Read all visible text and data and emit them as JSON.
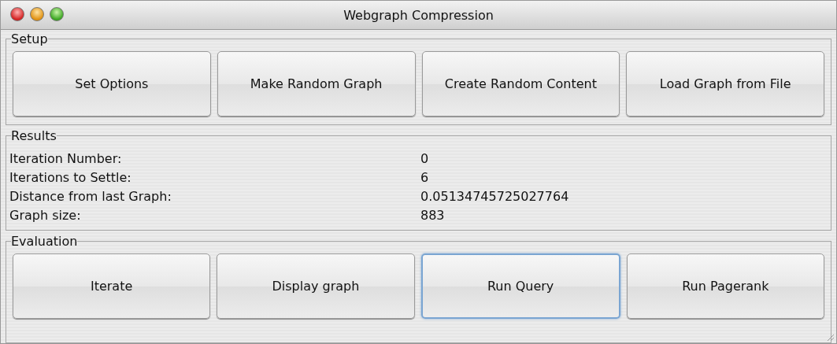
{
  "window": {
    "title": "Webgraph Compression"
  },
  "setup": {
    "title": "Setup",
    "buttons": [
      {
        "label": "Set Options",
        "focused": false
      },
      {
        "label": "Make Random Graph",
        "focused": false
      },
      {
        "label": "Create Random Content",
        "focused": false
      },
      {
        "label": "Load Graph from File",
        "focused": false
      }
    ]
  },
  "results": {
    "title": "Results",
    "rows": [
      {
        "label": "Iteration Number:",
        "value": "0"
      },
      {
        "label": "Iterations to Settle:",
        "value": "6"
      },
      {
        "label": "Distance from last Graph:",
        "value": "0.05134745725027764"
      },
      {
        "label": "Graph size:",
        "value": "883"
      }
    ]
  },
  "evaluation": {
    "title": "Evaluation",
    "buttons": [
      {
        "label": "Iterate",
        "focused": false
      },
      {
        "label": "Display graph",
        "focused": false
      },
      {
        "label": "Run Query",
        "focused": true
      },
      {
        "label": "Run Pagerank",
        "focused": false
      }
    ]
  }
}
